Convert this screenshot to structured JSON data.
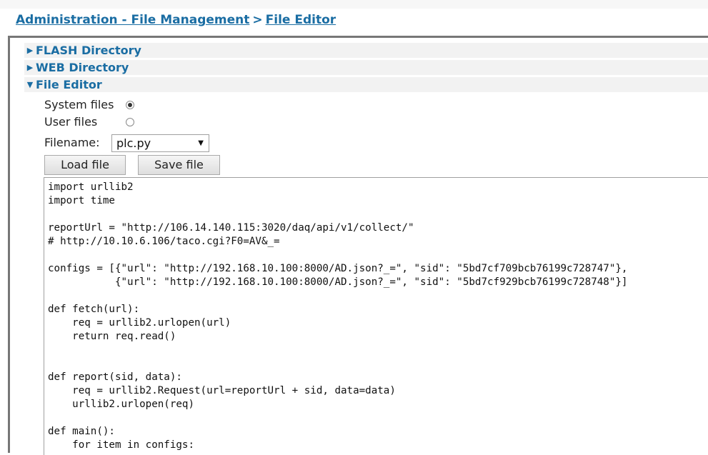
{
  "breadcrumb": {
    "part1": "Administration - File Management",
    "separator": ">",
    "part2": "File Editor"
  },
  "sections": [
    {
      "label": "FLASH Directory",
      "expanded": false
    },
    {
      "label": "WEB Directory",
      "expanded": false
    },
    {
      "label": "File Editor",
      "expanded": true
    }
  ],
  "file_editor": {
    "system_files_label": "System files",
    "user_files_label": "User files",
    "selected_source": "System files",
    "filename_label": "Filename:",
    "filename_value": "plc.py",
    "load_button": "Load file",
    "save_button": "Save file"
  },
  "code": [
    "import urllib2",
    "import time",
    "",
    "reportUrl = \"http://106.14.140.115:3020/daq/api/v1/collect/\"",
    "# http://10.10.6.106/taco.cgi?F0=AV&_=",
    "",
    "configs = [{\"url\": \"http://192.168.10.100:8000/AD.json?_=\", \"sid\": \"5bd7cf709bcb76199c728747\"},",
    "           {\"url\": \"http://192.168.10.100:8000/AD.json?_=\", \"sid\": \"5bd7cf929bcb76199c728748\"}]",
    "",
    "def fetch(url):",
    "    req = urllib2.urlopen(url)",
    "    return req.read()",
    "",
    "",
    "def report(sid, data):",
    "    req = urllib2.Request(url=reportUrl + sid, data=data)",
    "    urllib2.urlopen(req)",
    "",
    "def main():",
    "    for item in configs:"
  ],
  "colors": {
    "link": "#1a6da3",
    "section_bg": "#f2f2f2",
    "panel_border": "#777777"
  }
}
